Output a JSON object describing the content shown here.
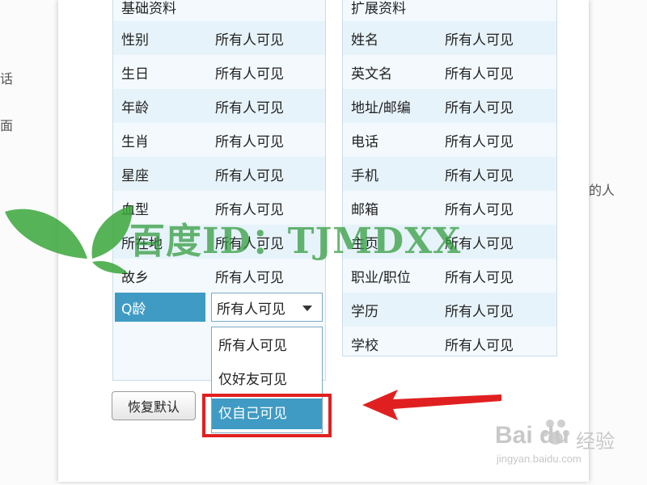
{
  "background": {
    "left_fragments": [
      "话",
      "面"
    ],
    "right_fragment": "的人",
    "bottom_fragment": "…"
  },
  "left_panel": {
    "title": "基础资料",
    "rows": [
      {
        "label": "性别",
        "value": "所有人可见"
      },
      {
        "label": "生日",
        "value": "所有人可见"
      },
      {
        "label": "年龄",
        "value": "所有人可见"
      },
      {
        "label": "生肖",
        "value": "所有人可见"
      },
      {
        "label": "星座",
        "value": "所有人可见"
      },
      {
        "label": "血型",
        "value": "所有人可见"
      },
      {
        "label": "所在地",
        "value": "所有人可见"
      },
      {
        "label": "故乡",
        "value": "所有人可见"
      }
    ],
    "qq_age": {
      "label": "Q龄",
      "selected": "所有人可见",
      "options": [
        "所有人可见",
        "仅好友可见",
        "仅自己可见"
      ],
      "highlighted_option": "仅自己可见"
    }
  },
  "right_panel": {
    "title": "扩展资料",
    "rows": [
      {
        "label": "姓名",
        "value": "所有人可见"
      },
      {
        "label": "英文名",
        "value": "所有人可见"
      },
      {
        "label": "地址/邮编",
        "value": "所有人可见"
      },
      {
        "label": "电话",
        "value": "所有人可见"
      },
      {
        "label": "手机",
        "value": "所有人可见"
      },
      {
        "label": "邮箱",
        "value": "所有人可见"
      },
      {
        "label": "主页",
        "value": "所有人可见"
      },
      {
        "label": "职业/职位",
        "value": "所有人可见"
      },
      {
        "label": "学历",
        "value": "所有人可见"
      },
      {
        "label": "学校",
        "value": "所有人可见"
      }
    ]
  },
  "restore_button": "恢复默认",
  "watermark": {
    "text": "百度ID：TJMDXX",
    "color": "#2e9a3a"
  },
  "logo": {
    "brand": "Bai du",
    "product": "经验",
    "url": "jingyan.baidu.com"
  },
  "colors": {
    "accent": "#3f9bc4",
    "row_alt": "#e7f3fb",
    "highlight": "#e02020"
  }
}
